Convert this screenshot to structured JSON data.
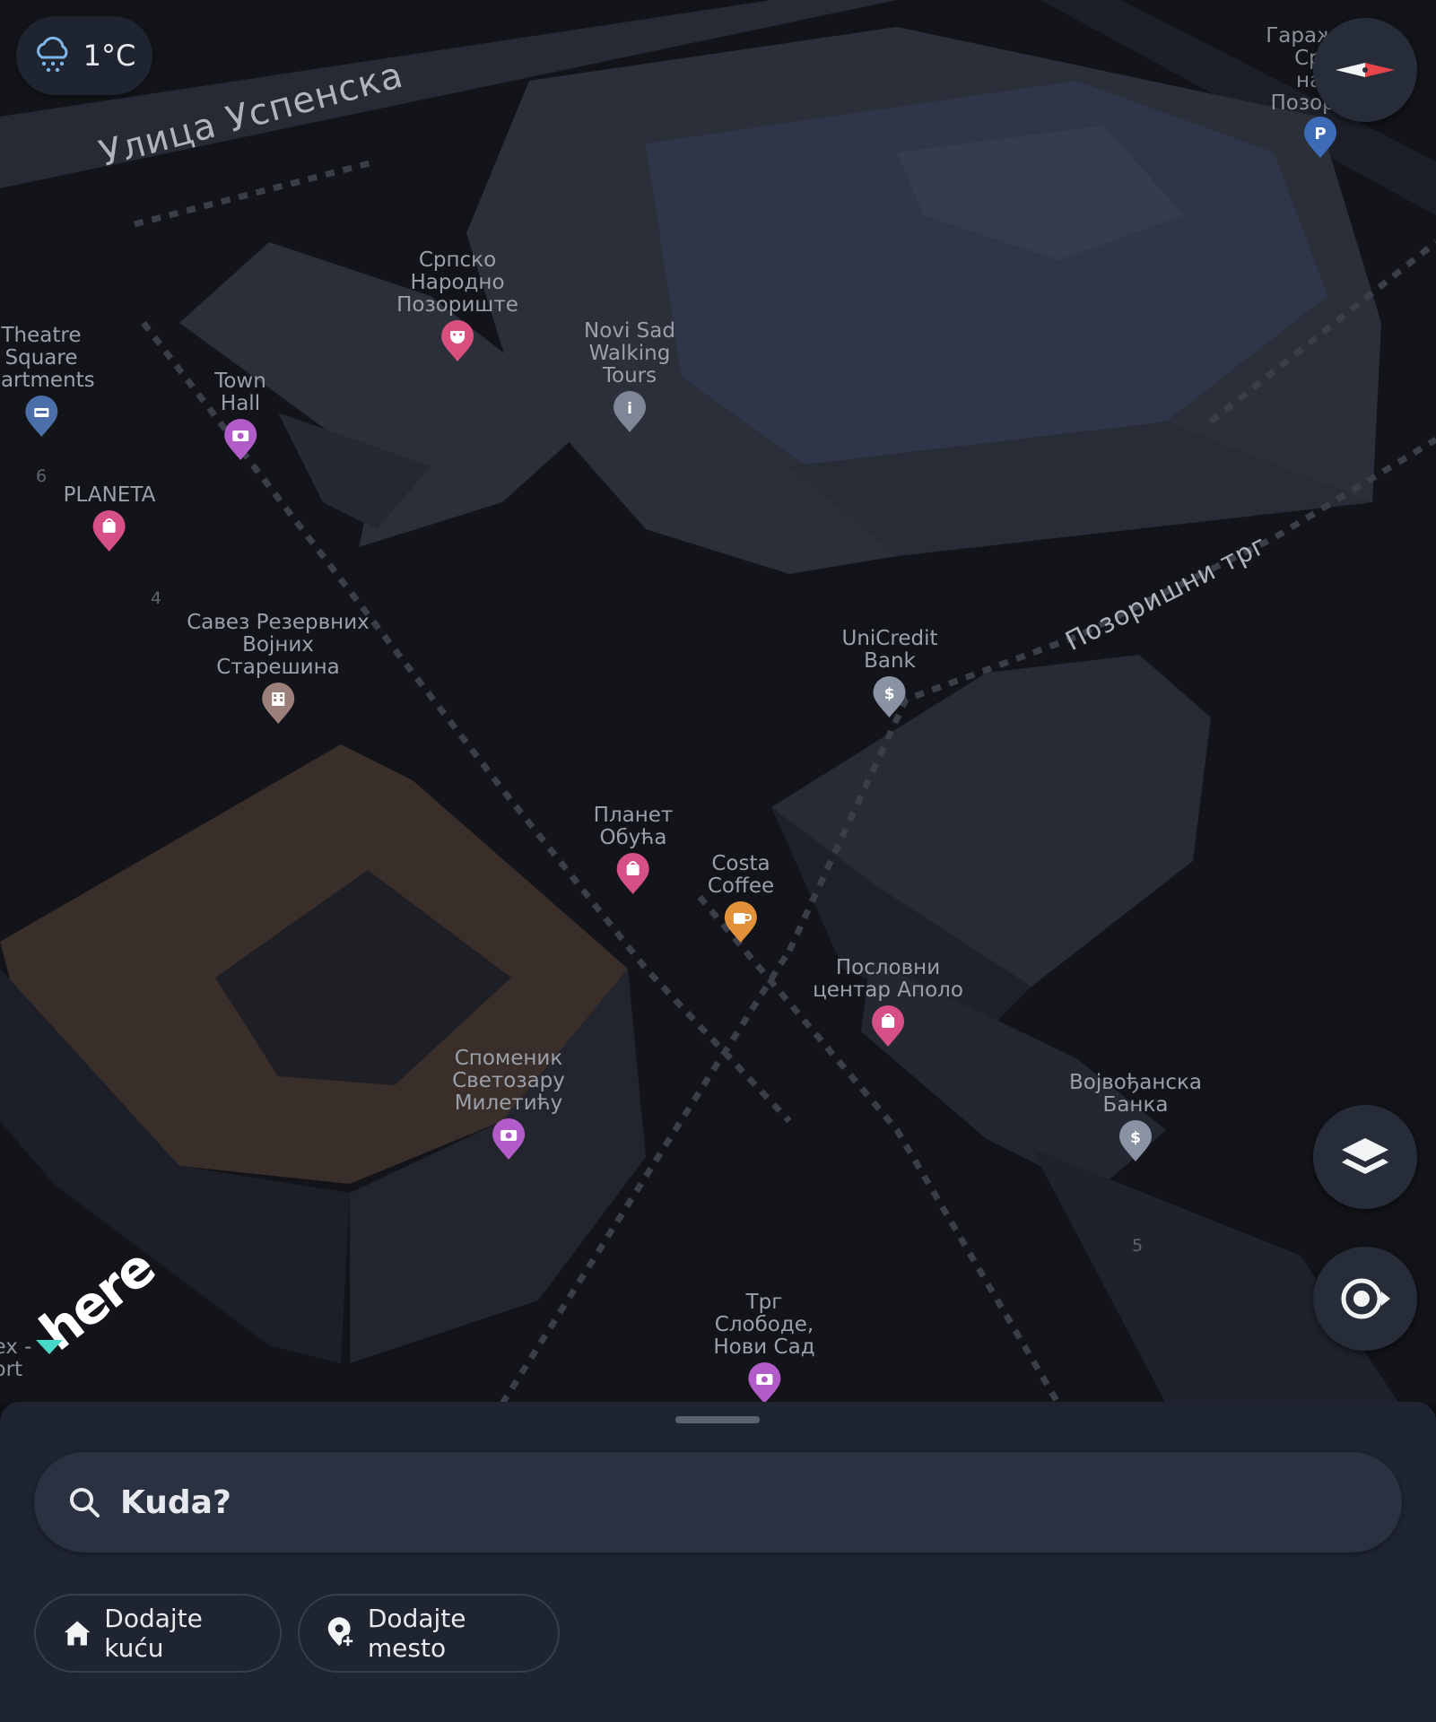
{
  "weather": {
    "temperature": "1°C",
    "icon": "snow-cloud-icon"
  },
  "streets": {
    "uspenska": "Улица Успенска",
    "pozorisni_trg": "Позоришни трг"
  },
  "pois": [
    {
      "id": "srpsko-narodno-pozoriste",
      "lines": [
        "Српско",
        "Народно",
        "Позориште"
      ],
      "icon": "theater-mask-icon",
      "color": "#d9507f"
    },
    {
      "id": "novi-sad-walking-tours",
      "lines": [
        "Novi Sad",
        "Walking",
        "Tours"
      ],
      "icon": "info-icon",
      "color": "#7f8796"
    },
    {
      "id": "theatre-square-apartments",
      "lines": [
        "Theatre",
        "Square",
        "partments"
      ],
      "icon": "hotel-icon",
      "color": "#4b6fa8"
    },
    {
      "id": "town-hall",
      "lines": [
        "Town",
        "Hall"
      ],
      "icon": "camera-icon",
      "color": "#b15cc8"
    },
    {
      "id": "planeta",
      "lines": [
        "PLANETA"
      ],
      "icon": "shopping-bag-icon",
      "color": "#d64f86"
    },
    {
      "id": "savez-rezervnih",
      "lines": [
        "Савез Резервних",
        "Војних",
        "Старешина"
      ],
      "icon": "building-icon",
      "color": "#9b7f7a"
    },
    {
      "id": "unicredit-bank",
      "lines": [
        "UniCredit",
        "Bank"
      ],
      "icon": "dollar-icon",
      "color": "#8a93a3"
    },
    {
      "id": "planet-obuca",
      "lines": [
        "Планет",
        "Обућа"
      ],
      "icon": "shopping-bag-icon",
      "color": "#d64f86"
    },
    {
      "id": "costa-coffee",
      "lines": [
        "Costa",
        "Coffee"
      ],
      "icon": "coffee-icon",
      "color": "#e0913a"
    },
    {
      "id": "poslovni-centar-apolo",
      "lines": [
        "Пословни",
        "центар Аполо"
      ],
      "icon": "shopping-bag-icon",
      "color": "#d64f86"
    },
    {
      "id": "spomenik-svetozaru-miletichu",
      "lines": [
        "Споменик",
        "Светозару",
        "Милетићу"
      ],
      "icon": "camera-icon",
      "color": "#b15cc8"
    },
    {
      "id": "vojvodjanska-banka",
      "lines": [
        "Војвођанска",
        "Банка"
      ],
      "icon": "dollar-icon",
      "color": "#8a93a3"
    },
    {
      "id": "trg-slobode",
      "lines": [
        "Трг",
        "Слободе,",
        "Нови Сад"
      ],
      "icon": "camera-icon",
      "color": "#b15cc8"
    }
  ],
  "partial_labels": {
    "garaza": [
      "Гараж",
      "Срп",
      "нар",
      "Позор"
    ],
    "left_cut": [
      "ex -",
      "ort"
    ]
  },
  "house_numbers": [
    "6",
    "4",
    "5"
  ],
  "logo_text": "here",
  "controls": {
    "compass": "compass-icon",
    "layers": "layers-icon",
    "locate": "locate-icon"
  },
  "sheet": {
    "search_placeholder": "Kuda?",
    "chips": [
      {
        "label": "Dodajte kuću",
        "icon": "home-icon"
      },
      {
        "label": "Dodajte mesto",
        "icon": "add-place-icon"
      }
    ]
  }
}
